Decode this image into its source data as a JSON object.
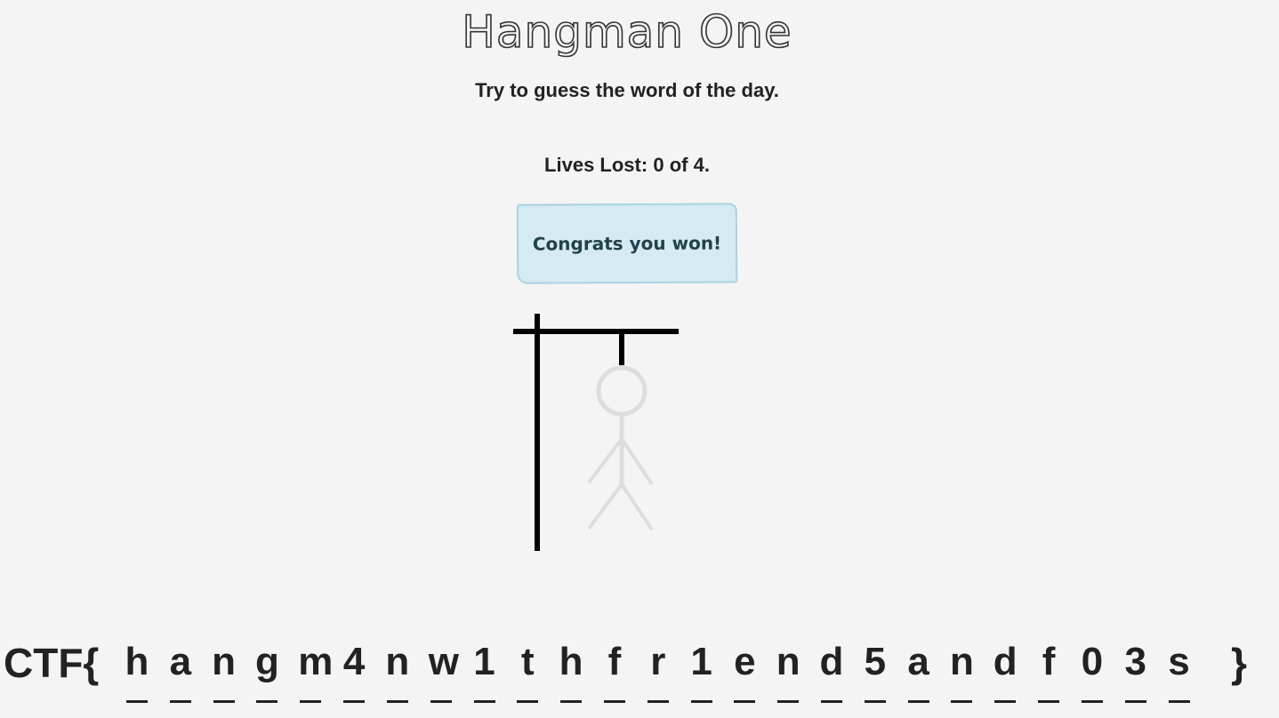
{
  "header": {
    "title": "Hangman One",
    "subtitle": "Try to guess the word of the day."
  },
  "status": {
    "lives_label": "Lives Lost:",
    "lives_lost": "0",
    "lives_sep": "of",
    "lives_total": "4.",
    "message": "Congrats you won!"
  },
  "colors": {
    "background": "#f4f4f4",
    "alert_bg": "#d5ebf1",
    "alert_border": "#a8d3e2",
    "gallows": "#000000",
    "figure": "#dddddd"
  },
  "word": {
    "prefix": "CTF{",
    "suffix": "}",
    "letters": [
      "h",
      "a",
      "n",
      "g",
      "m",
      "4",
      "n",
      "w",
      "1",
      "t",
      "h",
      "f",
      "r",
      "1",
      "e",
      "n",
      "d",
      "5",
      "a",
      "n",
      "d",
      "f",
      "0",
      "3",
      "s"
    ]
  }
}
